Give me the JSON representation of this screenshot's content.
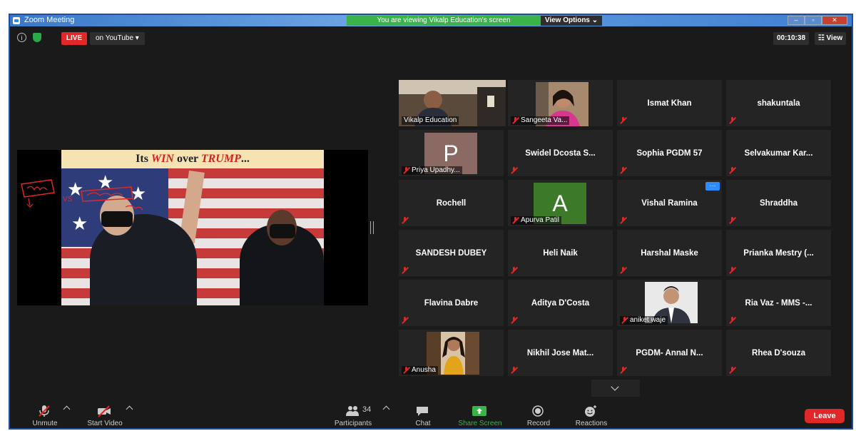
{
  "window": {
    "title": "Zoom Meeting",
    "viewing_banner": "You are viewing Vikalp Education's screen",
    "view_options": "View Options ⌄"
  },
  "topbar": {
    "live_label": "LIVE",
    "youtube_label": "on YouTube ▾",
    "timer": "00:10:38",
    "view_label": "☷ View"
  },
  "slide": {
    "title_prefix": "Its ",
    "title_win": "WIN",
    "title_mid": " over ",
    "title_trump": "TRUMP",
    "title_suffix": "..."
  },
  "participants": [
    {
      "type": "video",
      "label": "Vikalp Education",
      "active": true,
      "muted": false
    },
    {
      "type": "video",
      "label": "Sangeeta Va...",
      "muted": true
    },
    {
      "type": "name",
      "name": "Ismat Khan",
      "muted": true
    },
    {
      "type": "name",
      "name": "shakuntala",
      "muted": true
    },
    {
      "type": "letter",
      "letter": "P",
      "label": "Priya Upadhy...",
      "color": "#8a6a62",
      "muted": true
    },
    {
      "type": "name",
      "name": "Swidel Dcosta S...",
      "muted": true
    },
    {
      "type": "name",
      "name": "Sophia PGDM 57",
      "muted": true
    },
    {
      "type": "name",
      "name": "Selvakumar Kar...",
      "muted": true
    },
    {
      "type": "name",
      "name": "Rochell",
      "muted": true
    },
    {
      "type": "letter",
      "letter": "A",
      "label": "Apurva Patil",
      "color": "#3c7a2a",
      "muted": true
    },
    {
      "type": "name",
      "name": "Vishal Ramina",
      "muted": true,
      "more": "···"
    },
    {
      "type": "name",
      "name": "Shraddha",
      "muted": true
    },
    {
      "type": "name",
      "name": "SANDESH DUBEY",
      "muted": true
    },
    {
      "type": "name",
      "name": "Heli Naik",
      "muted": true
    },
    {
      "type": "name",
      "name": "Harshal Maske",
      "muted": true
    },
    {
      "type": "name",
      "name": "Prianka Mestry (...",
      "muted": true
    },
    {
      "type": "name",
      "name": "Flavina Dabre",
      "muted": true
    },
    {
      "type": "name",
      "name": "Aditya D'Costa",
      "muted": true
    },
    {
      "type": "video",
      "label": "aniket waje",
      "muted": true
    },
    {
      "type": "name",
      "name": "Ria Vaz - MMS -...",
      "muted": true
    },
    {
      "type": "video",
      "label": "Anusha",
      "muted": true
    },
    {
      "type": "name",
      "name": "Nikhil Jose Mat...",
      "muted": true
    },
    {
      "type": "name",
      "name": "PGDM- Annal N...",
      "muted": true
    },
    {
      "type": "name",
      "name": "Rhea D'souza",
      "muted": true
    }
  ],
  "toolbar": {
    "unmute": "Unmute",
    "start_video": "Start Video",
    "participants": "Participants",
    "participant_count": "34",
    "chat": "Chat",
    "share_screen": "Share Screen",
    "record": "Record",
    "reactions": "Reactions",
    "leave": "Leave"
  },
  "colors": {
    "frame_border": "#1c4fa1",
    "live_red": "#e02828",
    "share_green": "#3bb34a",
    "active_speaker": "#c4e24a",
    "zoom_blue": "#2d8cff"
  }
}
